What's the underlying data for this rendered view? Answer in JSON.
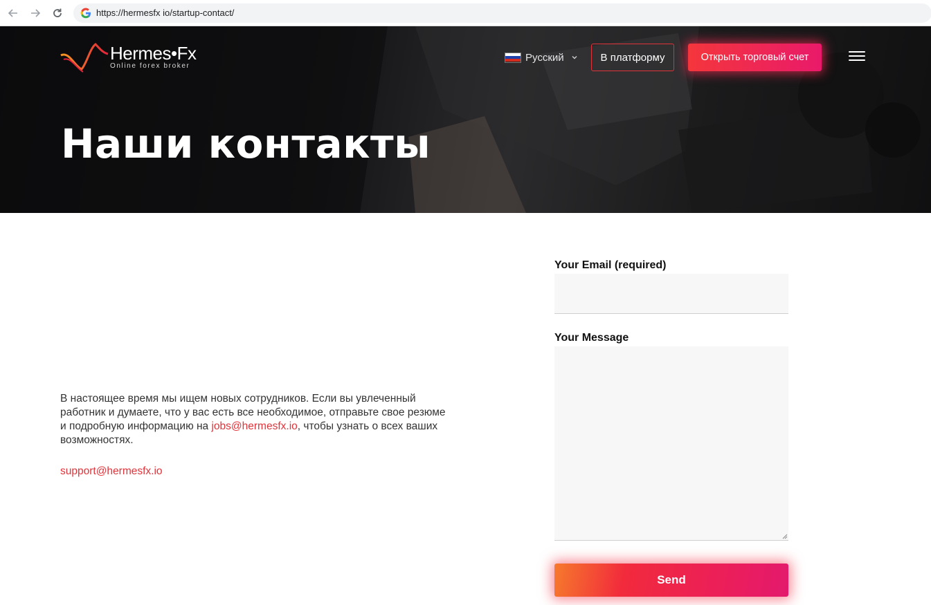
{
  "browser": {
    "url": "https://hermesfx io/startup-contact/"
  },
  "header": {
    "logo_text": "Hermes•Fx",
    "logo_subtitle": "Online forex broker",
    "language": "Русский",
    "platform_label": "В платформу",
    "open_account_label": "Открыть торговый счет"
  },
  "hero": {
    "title": "Наши контакты"
  },
  "content": {
    "intro_text": "В настоящее время мы ищем новых сотрудников. Если вы увлеченный работник и думаете, что у вас есть все необходимое, отправьте свое резюме и подробную информацию на ",
    "jobs_email": "jobs@hermesfx.io",
    "intro_suffix": ", чтобы узнать о всех ваших возможностях.",
    "support_email": "support@hermesfx.io"
  },
  "form": {
    "email_label": "Your Email (required)",
    "email_value": "",
    "message_label": "Your Message",
    "message_value": "",
    "send_label": "Send"
  },
  "colors": {
    "accent": "#e2333a",
    "button_gradient_start": "#f4363c",
    "button_gradient_end": "#e91a6a"
  },
  "icons": {
    "back": "arrow-left-icon",
    "forward": "arrow-right-icon",
    "reload": "reload-icon",
    "site": "google-icon",
    "language_flag": "russia-flag-icon",
    "dropdown": "chevron-down-icon",
    "menu": "hamburger-menu-icon"
  }
}
